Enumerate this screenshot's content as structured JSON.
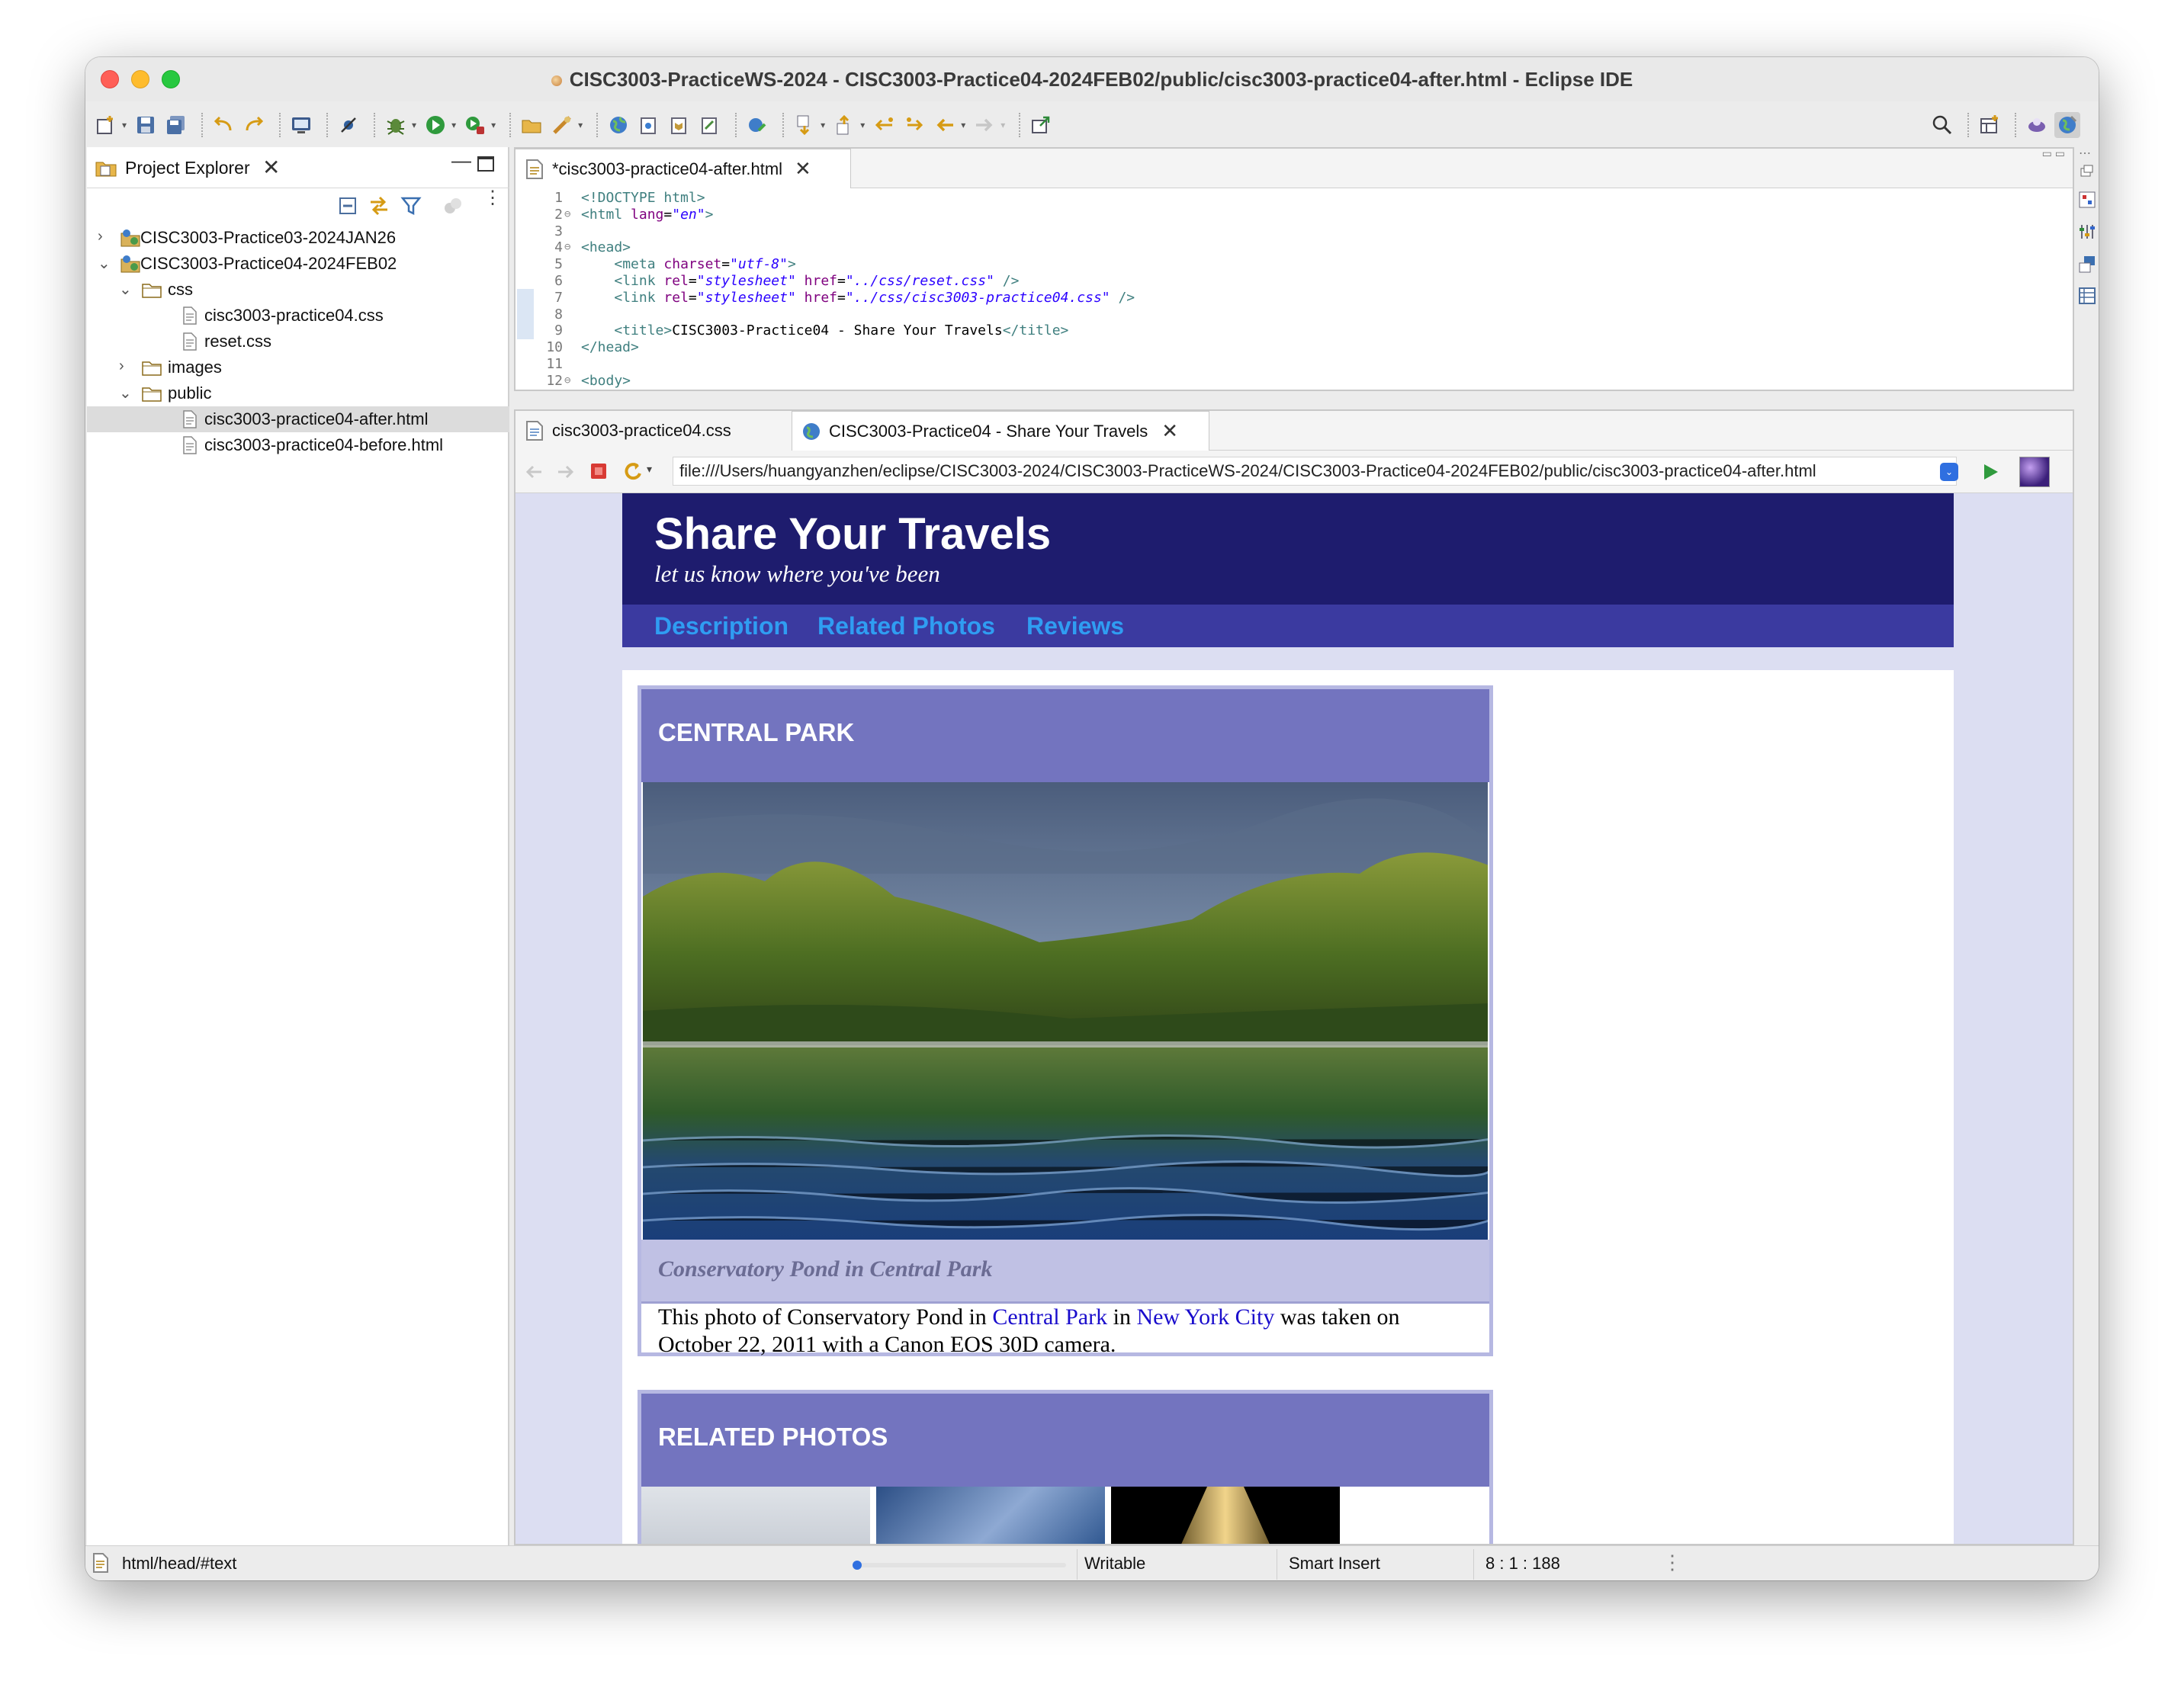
{
  "window": {
    "title": "CISC3003-PracticeWS-2024 - CISC3003-Practice04-2024FEB02/public/cisc3003-practice04-after.html - Eclipse IDE",
    "traffic_lights": [
      "#ff5f57",
      "#febc2e",
      "#28c840"
    ]
  },
  "project_explorer": {
    "tab_label": "Project Explorer",
    "tree": [
      {
        "label": "CISC3003-Practice03-2024JAN26",
        "kind": "project",
        "expanded": false
      },
      {
        "label": "CISC3003-Practice04-2024FEB02",
        "kind": "project",
        "expanded": true
      },
      {
        "label": "css",
        "kind": "folder",
        "expanded": true
      },
      {
        "label": "cisc3003-practice04.css",
        "kind": "file"
      },
      {
        "label": "reset.css",
        "kind": "file"
      },
      {
        "label": "images",
        "kind": "folder",
        "expanded": false
      },
      {
        "label": "public",
        "kind": "folder",
        "expanded": true
      },
      {
        "label": "cisc3003-practice04-after.html",
        "kind": "file",
        "selected": true
      },
      {
        "label": "cisc3003-practice04-before.html",
        "kind": "file"
      }
    ]
  },
  "editor": {
    "tab_label": "*cisc3003-practice04-after.html",
    "current_line": 8,
    "lines": [
      {
        "n": "1",
        "fold": "",
        "tokens": [
          [
            "kw",
            "<!DOCTYPE html>"
          ]
        ]
      },
      {
        "n": "2",
        "fold": "⊖",
        "tokens": [
          [
            "kw",
            "<html "
          ],
          [
            "at",
            "lang"
          ],
          [
            "tx0",
            "="
          ],
          [
            "sv",
            "\"en\""
          ],
          [
            "kw",
            ">"
          ]
        ]
      },
      {
        "n": "3",
        "fold": "",
        "tokens": []
      },
      {
        "n": "4",
        "fold": "⊖",
        "tokens": [
          [
            "kw",
            "<head>"
          ]
        ]
      },
      {
        "n": "5",
        "fold": "",
        "tokens": [
          [
            "tx0",
            "    "
          ],
          [
            "kw",
            "<meta "
          ],
          [
            "at",
            "charset"
          ],
          [
            "tx0",
            "="
          ],
          [
            "sv",
            "\"utf-8\""
          ],
          [
            "kw",
            ">"
          ]
        ]
      },
      {
        "n": "6",
        "fold": "",
        "tokens": [
          [
            "tx0",
            "    "
          ],
          [
            "kw",
            "<link "
          ],
          [
            "at",
            "rel"
          ],
          [
            "tx0",
            "="
          ],
          [
            "sv",
            "\"stylesheet\""
          ],
          [
            "tx0",
            " "
          ],
          [
            "at",
            "href"
          ],
          [
            "tx0",
            "="
          ],
          [
            "sv",
            "\"../css/reset.css\""
          ],
          [
            "kw",
            " />"
          ]
        ]
      },
      {
        "n": "7",
        "fold": "",
        "tokens": [
          [
            "tx0",
            "    "
          ],
          [
            "kw",
            "<link "
          ],
          [
            "at",
            "rel"
          ],
          [
            "tx0",
            "="
          ],
          [
            "sv",
            "\"stylesheet\""
          ],
          [
            "tx0",
            " "
          ],
          [
            "at",
            "href"
          ],
          [
            "tx0",
            "="
          ],
          [
            "sv",
            "\"../css/cisc3003-practice04.css\""
          ],
          [
            "kw",
            " />"
          ]
        ]
      },
      {
        "n": "8",
        "fold": "",
        "tokens": []
      },
      {
        "n": "9",
        "fold": "",
        "tokens": [
          [
            "tx0",
            "    "
          ],
          [
            "kw",
            "<title>"
          ],
          [
            "tx0",
            "CISC3003-Practice04 - Share Your Travels"
          ],
          [
            "kw",
            "</title>"
          ]
        ]
      },
      {
        "n": "10",
        "fold": "",
        "tokens": [
          [
            "kw",
            "</head>"
          ]
        ]
      },
      {
        "n": "11",
        "fold": "",
        "tokens": []
      },
      {
        "n": "12",
        "fold": "⊖",
        "tokens": [
          [
            "kw",
            "<body>"
          ]
        ]
      }
    ]
  },
  "browser": {
    "tabs": [
      {
        "label": "cisc3003-practice04.css"
      },
      {
        "label": "CISC3003-Practice04 - Share Your Travels",
        "active": true
      }
    ],
    "url": "file:///Users/huangyanzhen/eclipse/CISC3003-2024/CISC3003-PracticeWS-2024/CISC3003-Practice04-2024FEB02/public/cisc3003-practice04-after.html",
    "page": {
      "title": "Share Your Travels",
      "subtitle": "let us know where you've been",
      "nav": [
        "Description",
        "Related Photos",
        "Reviews"
      ],
      "card1": {
        "heading": "CENTRAL PARK",
        "caption": "Conservatory Pond in Central Park",
        "desc_1": "This photo of Conservatory Pond in ",
        "link_1": "Central Park",
        "desc_2": " in ",
        "link_2": "New York City",
        "desc_3": " was taken on October 22, 2011 with a Canon EOS 30D camera."
      },
      "card2": {
        "heading": "RELATED PHOTOS"
      }
    }
  },
  "status": {
    "path": "html/head/#text",
    "mode": "Writable",
    "insert": "Smart Insert",
    "position": "8 : 1 : 188"
  }
}
